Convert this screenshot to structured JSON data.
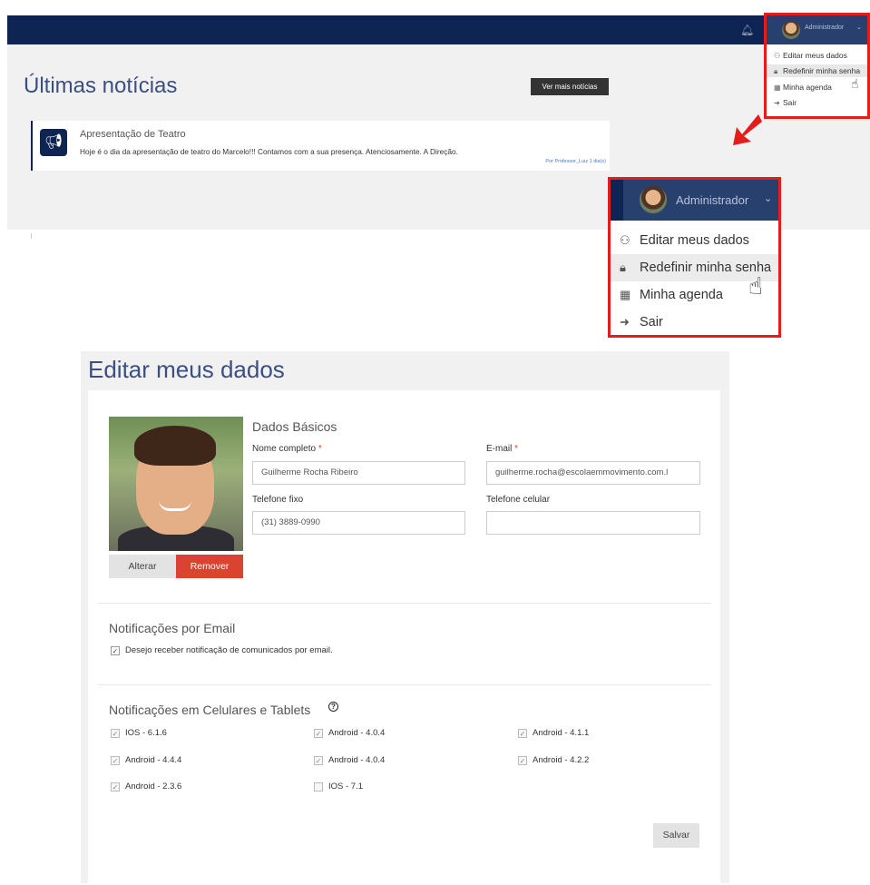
{
  "dashboard": {
    "notifications_icon": "bell-icon",
    "user_name": "Administrador",
    "news_heading": "Últimas notícias",
    "more_news_button": "Ver mais notícias",
    "news_item": {
      "icon": "megaphone-icon",
      "title": "Apresentação de Teatro",
      "body": "Hoje é o dia da apresentação de teatro do Marcelo!!! Contamos com a sua presença. Atenciosamente. A Direção.",
      "byline": "Por Professor_Luiz 1 dia(s)"
    }
  },
  "user_menu": {
    "user_name": "Administrador",
    "items": [
      {
        "icon": "user-icon",
        "label": "Editar meus dados"
      },
      {
        "icon": "lock-icon",
        "label": "Redefinir minha senha"
      },
      {
        "icon": "calendar-icon",
        "label": "Minha agenda"
      },
      {
        "icon": "sign-out-icon",
        "label": "Sair"
      }
    ],
    "highlighted_item": "Redefinir minha senha",
    "highlight_color": "#e31c1c"
  },
  "profile_form": {
    "title": "Editar meus dados",
    "photo_buttons": {
      "change": "Alterar",
      "remove": "Remover"
    },
    "basic": {
      "heading": "Dados Básicos",
      "full_name_label": "Nome completo",
      "full_name_value": "Guilherme Rocha Ribeiro",
      "email_label": "E-mail",
      "email_value": "guilherme.rocha@escolaemmovimento.com.l",
      "phone_label": "Telefone fixo",
      "phone_value": "(31) 3889-0990",
      "mobile_label": "Telefone celular",
      "mobile_value": "",
      "required_mark": "*"
    },
    "email_notifications": {
      "heading": "Notificações por Email",
      "option_label": "Desejo receber notificação de comunicados por email.",
      "checked": true
    },
    "device_notifications": {
      "heading": "Notificações em Celulares e Tablets",
      "help_icon": "question-circle-icon",
      "devices": [
        {
          "label": "IOS - 6.1.6",
          "checked": true
        },
        {
          "label": "Android - 4.0.4",
          "checked": true
        },
        {
          "label": "Android - 4.1.1",
          "checked": true
        },
        {
          "label": "Android - 4.4.4",
          "checked": true
        },
        {
          "label": "Android - 4.0.4",
          "checked": true
        },
        {
          "label": "Android - 4.2.2",
          "checked": true
        },
        {
          "label": "Android - 2.3.6",
          "checked": true
        },
        {
          "label": "IOS - 7.1",
          "checked": false
        }
      ]
    },
    "save_button": "Salvar",
    "colors": {
      "brand_navy": "#0e2452",
      "remove_red": "#d9432f",
      "heading_blue": "#3b4f82"
    }
  }
}
